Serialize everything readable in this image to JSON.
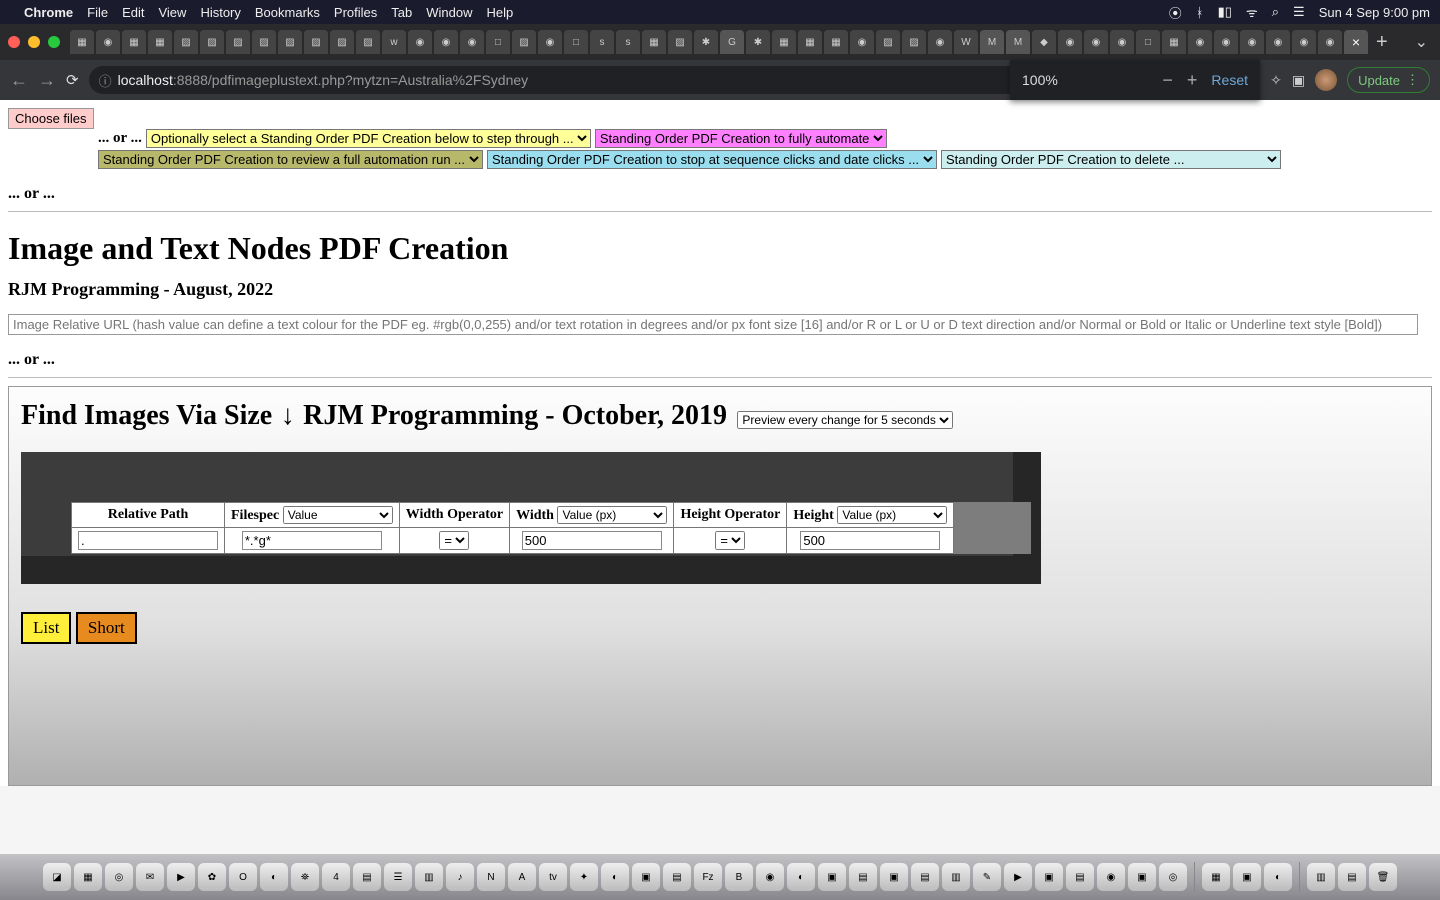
{
  "mac_menu": {
    "app": "Chrome",
    "items": [
      "File",
      "Edit",
      "View",
      "History",
      "Bookmarks",
      "Profiles",
      "Tab",
      "Window",
      "Help"
    ],
    "clock": "Sun 4 Sep  9:00 pm"
  },
  "chrome": {
    "url_host": "localhost",
    "url_port": ":8888",
    "url_path": "/pdfimageplustext.php?mytzn=Australia%2FSydney",
    "update_label": "Update"
  },
  "zoom": {
    "value": "100%",
    "reset": "Reset"
  },
  "toprow": {
    "choose_files": "Choose files",
    "or": "... or ...",
    "sel_optional": "Optionally select a Standing Order PDF Creation below to step through ...",
    "sel_fully": "Standing Order PDF Creation to fully automate",
    "sel_review": "Standing Order PDF Creation to review a full automation run ...",
    "sel_stop": "Standing Order PDF Creation to stop at sequence clicks and date clicks ...",
    "sel_delete": "Standing Order PDF Creation to delete ..."
  },
  "body_or": "... or ...",
  "main_title": "Image and Text Nodes PDF Creation",
  "sub_title": "RJM Programming - August, 2022",
  "url_placeholder": "Image Relative URL (hash value can define a text colour for the PDF eg. #rgb(0,0,255) and/or text rotation in degrees and/or px font size [16] and/or R or L or U or D text direction and/or Normal or Bold or Italic or Underline text style [Bold])",
  "body_or2": "... or ...",
  "frame": {
    "heading_a": "Find Images Via Size",
    "heading_b": "RJM Programming - October, 2019",
    "preview_sel": "Preview every change for 5 seconds",
    "headers": {
      "relpath": "Relative Path",
      "filespec": "Filespec",
      "filespec_sel": "Value",
      "widthop": "Width Operator",
      "width": "Width",
      "width_sel": "Value (px)",
      "heightop": "Height Operator",
      "height": "Height",
      "height_sel": "Value (px)"
    },
    "row": {
      "relpath": ".",
      "filespec": "*.*g*",
      "widthop": "=",
      "width": "500",
      "heightop": "=",
      "height": "500"
    },
    "btn_list": "List",
    "btn_short": "Short"
  }
}
